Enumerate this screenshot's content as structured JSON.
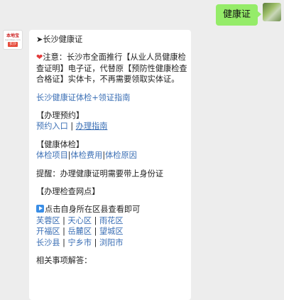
{
  "outgoing": {
    "text": "健康证"
  },
  "bot": {
    "avatar_title": "本地宝",
    "avatar_sub": "bendibao.com",
    "avatar_city": "长沙"
  },
  "msg": {
    "title": "➤长沙健康证",
    "note_heart": "❤",
    "note": [
      "注意：长沙市全面推行【从业人员健康检",
      "查证明】电子证，代替原【预防性健康检查",
      "合格证】实体卡，不再需要领取实体证。"
    ],
    "guide_link": "长沙健康证体检+领证指南",
    "appointment_header": "【办理预约】",
    "appointment_link1": "预约入口",
    "appointment_sep": " | ",
    "appointment_link2": "办理指南",
    "exam_header": "【健康体检】",
    "exam_link1": "体检项目",
    "exam_link2": "体检费用",
    "exam_link3": "体检原因",
    "exam_sep": "|",
    "reminder": "提醒：办理健康证明需要带上身份证",
    "points_header": "【办理检查网点】",
    "points_hint": "点击自身所在区县查看即可",
    "district_sep": " | ",
    "districts": [
      [
        "芙蓉区",
        "天心区",
        "雨花区"
      ],
      [
        "开福区",
        "岳麓区",
        "望城区"
      ],
      [
        "长沙县",
        "宁乡市",
        "浏阳市"
      ]
    ],
    "related": "相关事项解答："
  }
}
